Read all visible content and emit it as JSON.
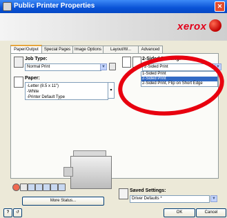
{
  "window": {
    "title": "Public Printer Properties",
    "close_glyph": "✕"
  },
  "brand": {
    "logo_text": "xerox"
  },
  "tabs": [
    "Paper/Output",
    "Special Pages",
    "Image Options",
    "Layout/W...",
    "Advanced"
  ],
  "paper_output": {
    "job_type_label": "Job Type:",
    "job_type_value": "Normal Print",
    "paper_label": "Paper:",
    "paper_lines": [
      "-Letter (8.5 x 11\")",
      "-White",
      "-Printer Default Type"
    ],
    "two_sided_label": "2-Sided Printing:",
    "two_sided_value": "2-Sided Print",
    "two_sided_options": [
      "1-Sided Print",
      "2-Sided Print",
      "2-Sided Print, Flip on Short Edge"
    ],
    "two_sided_highlighted_index": 1
  },
  "footer": {
    "more_status_label": "More Status...",
    "saved_settings_label": "Saved Settings:",
    "saved_settings_value": "Driver Defaults *",
    "help_glyph": "?",
    "ok_label": "OK",
    "cancel_label": "Cancel"
  },
  "colors": {
    "title_bar": "#0a53d6",
    "xerox_red": "#e2001a",
    "highlight": "#316ac5",
    "oval": "#e8000f"
  }
}
